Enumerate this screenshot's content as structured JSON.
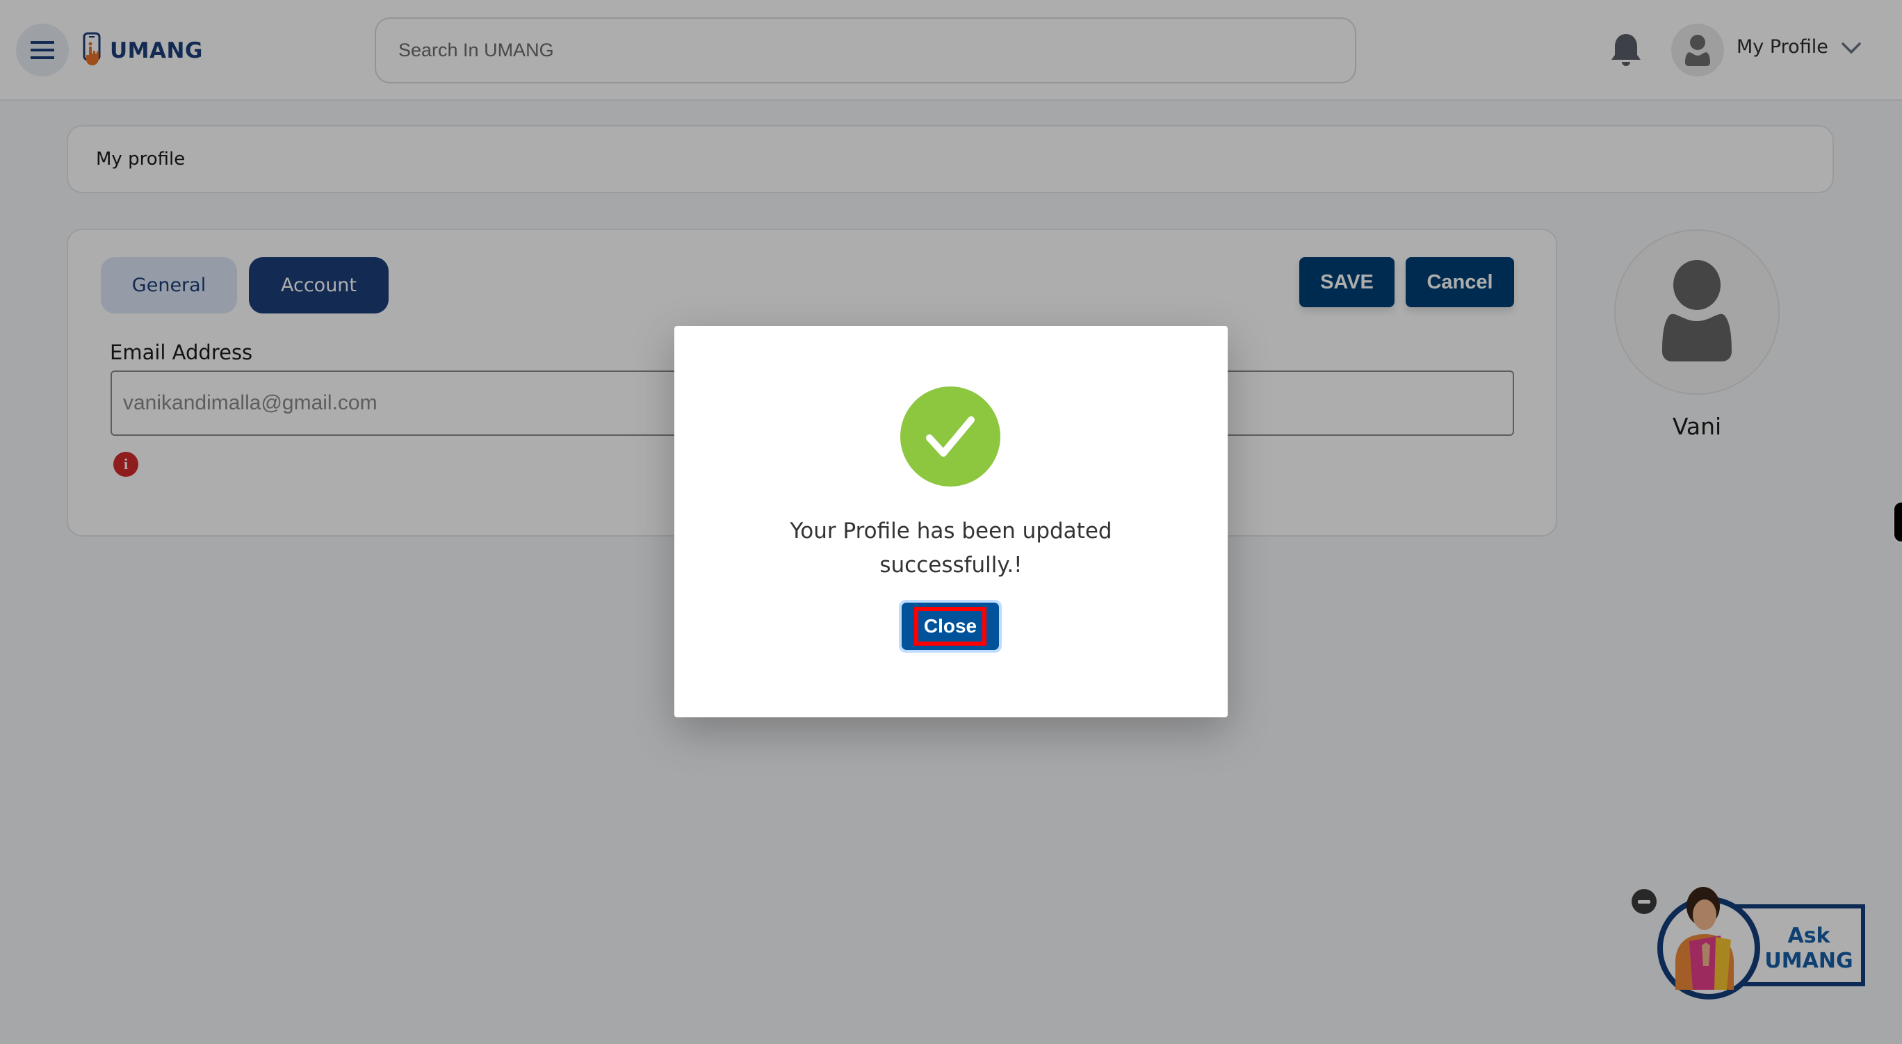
{
  "header": {
    "logo_text": "UMANG",
    "search_placeholder": "Search In UMANG",
    "profile_label": "My Profile",
    "icons": {
      "menu": "hamburger-icon",
      "notifications": "bell-icon",
      "avatar": "user-icon",
      "dropdown": "chevron-down-icon"
    }
  },
  "breadcrumb": {
    "title": "My profile"
  },
  "profile_form": {
    "tabs": [
      {
        "label": "General",
        "active": false
      },
      {
        "label": "Account",
        "active": true
      }
    ],
    "save_label": "SAVE",
    "cancel_label": "Cancel",
    "email_label": "Email Address",
    "email_value": "vanikandimalla@gmail.com",
    "info_icon": "i"
  },
  "user": {
    "name": "Vani"
  },
  "modal": {
    "message": "Your Profile has been updated successfully.!",
    "close_label": "Close",
    "icon": "check-circle-icon"
  },
  "chatbot": {
    "line1": "Ask",
    "line2": "UMANG"
  },
  "colors": {
    "brand_navy": "#1d3f7a",
    "button_blue": "#004077",
    "success_green": "#8dc63f",
    "error_red": "#d42b2b",
    "logo_orange": "#e8732a"
  }
}
